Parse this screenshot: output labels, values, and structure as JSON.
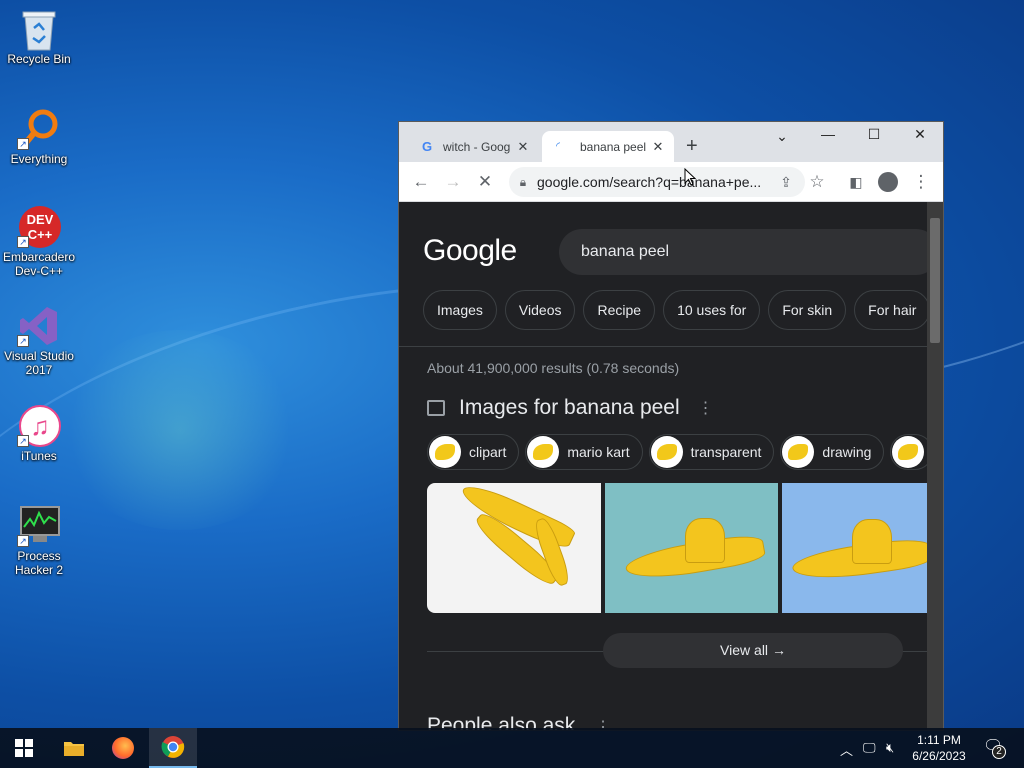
{
  "desktop": {
    "icons": [
      {
        "label": "Recycle Bin"
      },
      {
        "label": "Everything"
      },
      {
        "label": "Embarcadero Dev-C++",
        "line1": "Embarcadero",
        "line2": "Dev-C++",
        "logo": "DEV C++"
      },
      {
        "label": "Visual Studio 2017",
        "line1": "Visual Studio",
        "line2": "2017"
      },
      {
        "label": "iTunes"
      },
      {
        "label": "Process Hacker 2",
        "line1": "Process",
        "line2": "Hacker 2"
      }
    ]
  },
  "browser": {
    "tabs": [
      {
        "title": "witch - Goog",
        "favicon": "G",
        "active": false
      },
      {
        "title": "banana peel",
        "favicon": "loading-spinner",
        "active": true
      }
    ],
    "url": "google.com/search?q=banana+pe...",
    "search_query": "banana peel",
    "logo": "Google",
    "filter_chips": [
      "Images",
      "Videos",
      "Recipe",
      "10 uses for",
      "For skin",
      "For hair"
    ],
    "result_stats": "About 41,900,000 results (0.78 seconds)",
    "images_heading": "Images for banana peel",
    "image_chips": [
      "clipart",
      "mario kart",
      "transparent",
      "drawing"
    ],
    "view_all": "View all",
    "people_also_ask": "People also ask"
  },
  "taskbar": {
    "time": "1:11 PM",
    "date": "6/26/2023",
    "notification_count": "2"
  }
}
